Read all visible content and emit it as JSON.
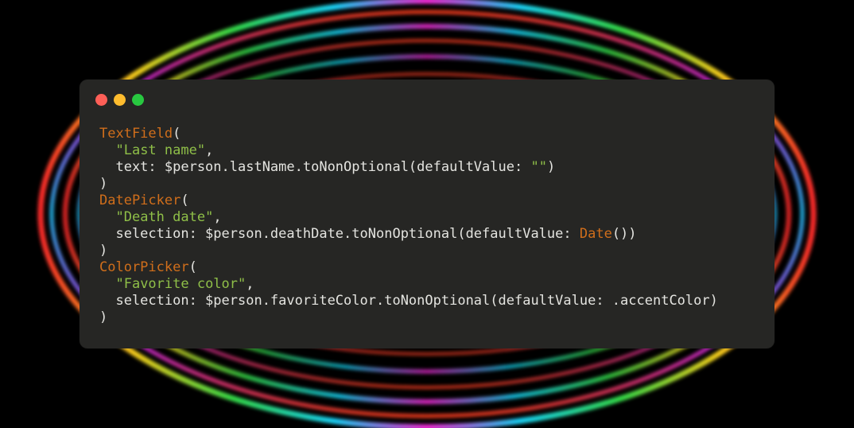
{
  "window": {
    "traffic_lights": [
      {
        "name": "close",
        "color": "#fe5f57"
      },
      {
        "name": "minimize",
        "color": "#febc2e"
      },
      {
        "name": "zoom",
        "color": "#28c840"
      }
    ]
  },
  "colors": {
    "type": "#d06e1b",
    "string": "#8fbf48",
    "plain": "#e4e4e0",
    "window_bg": "#262624"
  },
  "code": {
    "lines": [
      [
        {
          "t": "type",
          "v": "TextField"
        },
        {
          "t": "plain",
          "v": "("
        }
      ],
      [
        {
          "t": "plain",
          "v": "  "
        },
        {
          "t": "str",
          "v": "\"Last name\""
        },
        {
          "t": "plain",
          "v": ","
        }
      ],
      [
        {
          "t": "plain",
          "v": "  text: $person.lastName.toNonOptional(defaultValue: "
        },
        {
          "t": "str",
          "v": "\"\""
        },
        {
          "t": "plain",
          "v": ")"
        }
      ],
      [
        {
          "t": "plain",
          "v": ")"
        }
      ],
      [
        {
          "t": "type",
          "v": "DatePicker"
        },
        {
          "t": "plain",
          "v": "("
        }
      ],
      [
        {
          "t": "plain",
          "v": "  "
        },
        {
          "t": "str",
          "v": "\"Death date\""
        },
        {
          "t": "plain",
          "v": ","
        }
      ],
      [
        {
          "t": "plain",
          "v": "  selection: $person.deathDate.toNonOptional(defaultValue: "
        },
        {
          "t": "type",
          "v": "Date"
        },
        {
          "t": "plain",
          "v": "())"
        }
      ],
      [
        {
          "t": "plain",
          "v": ")"
        }
      ],
      [
        {
          "t": "type",
          "v": "ColorPicker"
        },
        {
          "t": "plain",
          "v": "("
        }
      ],
      [
        {
          "t": "plain",
          "v": "  "
        },
        {
          "t": "str",
          "v": "\"Favorite color\""
        },
        {
          "t": "plain",
          "v": ","
        }
      ],
      [
        {
          "t": "plain",
          "v": "  selection: $person.favoriteColor.toNonOptional(defaultValue: .accentColor)"
        }
      ],
      [
        {
          "t": "plain",
          "v": ")"
        }
      ]
    ]
  }
}
